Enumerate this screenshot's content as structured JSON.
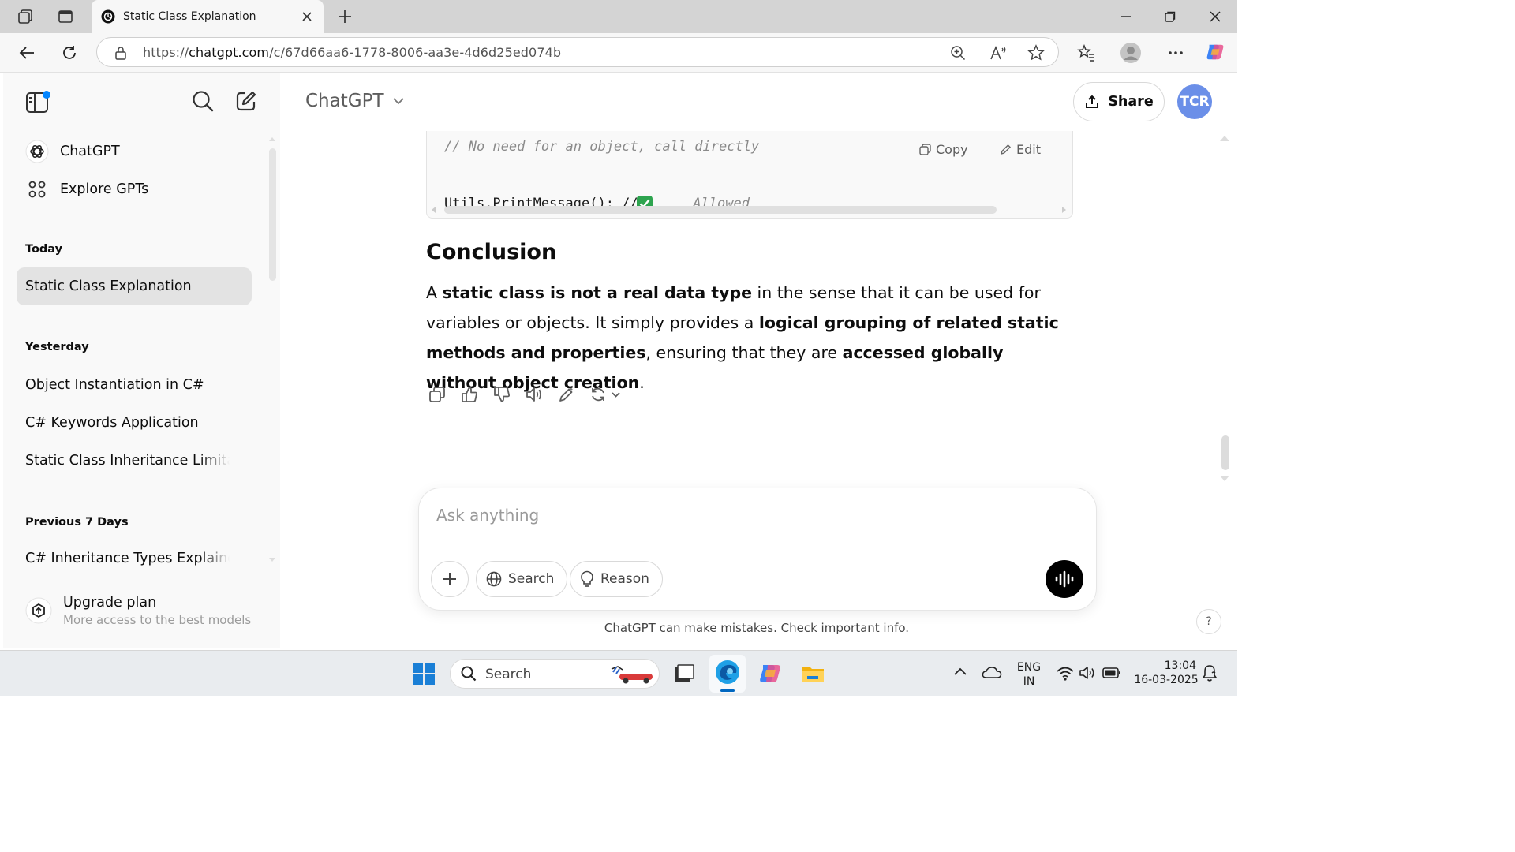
{
  "browser": {
    "tab_title": "Static Class Explanation",
    "url_prefix": "https://",
    "url_host": "chatgpt.com",
    "url_path": "/c/67d66aa6-1778-8006-aa3e-4d6d25ed074b"
  },
  "sidebar": {
    "nav": [
      {
        "label": "ChatGPT",
        "icon": "chatgpt-logo-icon"
      },
      {
        "label": "Explore GPTs",
        "icon": "grid-icon"
      }
    ],
    "sections": [
      {
        "heading": "Today",
        "items": [
          "Static Class Explanation"
        ]
      },
      {
        "heading": "Yesterday",
        "items": [
          "Object Instantiation in C#",
          "C# Keywords Application",
          "Static Class Inheritance Limitat"
        ]
      },
      {
        "heading": "Previous 7 Days",
        "items": [
          "C# Inheritance Types Explainec"
        ]
      }
    ],
    "upgrade": {
      "title": "Upgrade plan",
      "subtitle": "More access to the best models"
    }
  },
  "header": {
    "model_name": "ChatGPT",
    "share_label": "Share",
    "avatar_initials": "TCR"
  },
  "code": {
    "line1": "// No need for an object, call directly",
    "line2_code": "Utils.PrintMessage(); // ",
    "line2_comment": "Allowed",
    "copy_label": "Copy",
    "edit_label": "Edit"
  },
  "message": {
    "heading": "Conclusion",
    "p1": "A ",
    "b1": "static class is not a real data type",
    "p2": " in the sense that it can be used for variables or objects. It simply provides a ",
    "b2": "logical grouping of related static methods and properties",
    "p3": ", ensuring that they are ",
    "b3": "accessed globally without object creation",
    "p4": "."
  },
  "composer": {
    "placeholder": "Ask anything",
    "search_label": "Search",
    "reason_label": "Reason"
  },
  "footer": {
    "disclaimer": "ChatGPT can make mistakes. Check important info.",
    "help": "?"
  },
  "taskbar": {
    "search_label": "Search",
    "lang_top": "ENG",
    "lang_bottom": "IN",
    "time": "13:04",
    "date": "16-03-2025"
  },
  "colors": {
    "accent_blue": "#0078d4",
    "avatar_bg": "#6b8fe8",
    "check_green": "#2ea44f"
  }
}
